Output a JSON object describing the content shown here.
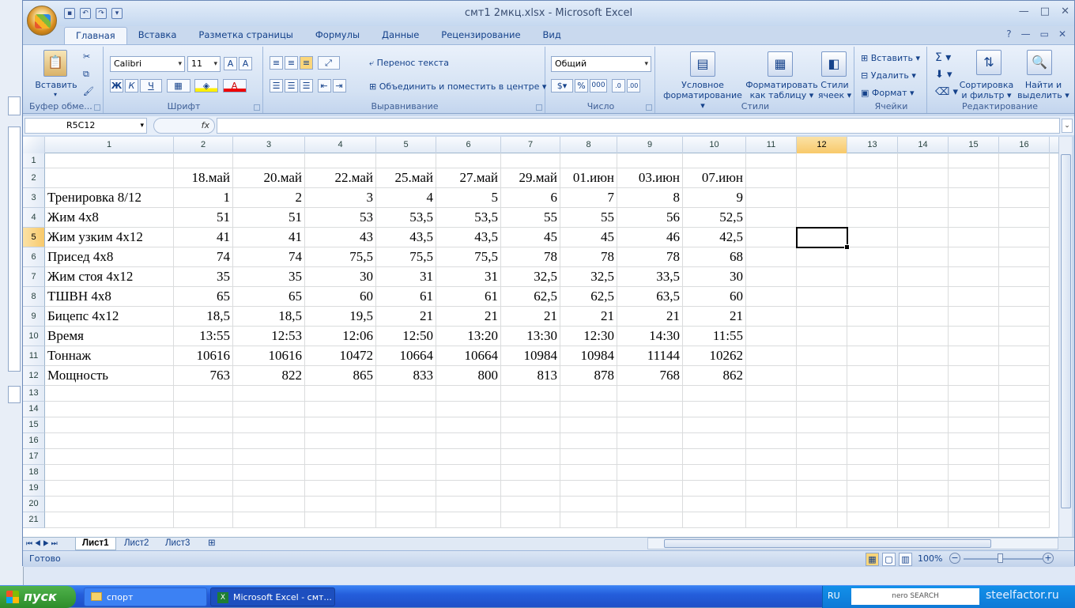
{
  "window": {
    "title": "смт1 2мкц.xlsx - Microsoft Excel"
  },
  "tabs": [
    "Главная",
    "Вставка",
    "Разметка страницы",
    "Формулы",
    "Данные",
    "Рецензирование",
    "Вид"
  ],
  "ribbon": {
    "clipboard": {
      "paste": "Вставить",
      "label": "Буфер обме..."
    },
    "font": {
      "name": "Calibri",
      "size": "11",
      "bold": "Ж",
      "italic": "К",
      "underline": "Ч",
      "label": "Шрифт"
    },
    "alignment": {
      "wrap": "Перенос текста",
      "merge": "Объединить и поместить в центре",
      "label": "Выравнивание"
    },
    "number": {
      "format": "Общий",
      "percent": "%",
      "thousands": "000",
      "label": "Число"
    },
    "styles": {
      "cond": [
        "Условное",
        "форматирование"
      ],
      "table": [
        "Форматировать",
        "как таблицу"
      ],
      "cells": [
        "Стили",
        "ячеек"
      ],
      "label": "Стили"
    },
    "cells": {
      "insert": "Вставить",
      "delete": "Удалить",
      "format": "Формат",
      "label": "Ячейки"
    },
    "editing": {
      "sort": [
        "Сортировка",
        "и фильтр"
      ],
      "find": [
        "Найти и",
        "выделить"
      ],
      "label": "Редактирование"
    }
  },
  "formula_bar": {
    "namebox": "R5C12",
    "fx": "fx",
    "value": ""
  },
  "grid": {
    "col_headers": [
      "1",
      "2",
      "3",
      "4",
      "5",
      "6",
      "7",
      "8",
      "9",
      "10",
      "11",
      "12",
      "13",
      "14",
      "15",
      "16"
    ],
    "row_headers": [
      "1",
      "2",
      "3",
      "4",
      "5",
      "6",
      "7",
      "8",
      "9",
      "10",
      "11",
      "12",
      "13",
      "14",
      "15",
      "16",
      "17",
      "18",
      "19",
      "20",
      "21"
    ],
    "rows": [
      [
        "",
        "",
        "",
        "",
        "",
        "",
        "",
        "",
        "",
        ""
      ],
      [
        "",
        "18.май",
        "20.май",
        "22.май",
        "25.май",
        "27.май",
        "29.май",
        "01.июн",
        "03.июн",
        "07.июн"
      ],
      [
        "Тренировка 8/12",
        "1",
        "2",
        "3",
        "4",
        "5",
        "6",
        "7",
        "8",
        "9"
      ],
      [
        "Жим 4х8",
        "51",
        "51",
        "53",
        "53,5",
        "53,5",
        "55",
        "55",
        "56",
        "52,5"
      ],
      [
        "Жим узким 4х12",
        "41",
        "41",
        "43",
        "43,5",
        "43,5",
        "45",
        "45",
        "46",
        "42,5"
      ],
      [
        "Присед 4х8",
        "74",
        "74",
        "75,5",
        "75,5",
        "75,5",
        "78",
        "78",
        "78",
        "68"
      ],
      [
        "Жим стоя 4х12",
        "35",
        "35",
        "30",
        "31",
        "31",
        "32,5",
        "32,5",
        "33,5",
        "30"
      ],
      [
        "ТШВН 4х8",
        "65",
        "65",
        "60",
        "61",
        "61",
        "62,5",
        "62,5",
        "63,5",
        "60"
      ],
      [
        "Бицепс 4х12",
        "18,5",
        "18,5",
        "19,5",
        "21",
        "21",
        "21",
        "21",
        "21",
        "21"
      ],
      [
        "Время",
        "13:55",
        "12:53",
        "12:06",
        "12:50",
        "13:20",
        "13:30",
        "12:30",
        "14:30",
        "11:55"
      ],
      [
        "Тоннаж",
        "10616",
        "10616",
        "10472",
        "10664",
        "10664",
        "10984",
        "10984",
        "11144",
        "10262"
      ],
      [
        "Мощность",
        "763",
        "822",
        "865",
        "833",
        "800",
        "813",
        "878",
        "768",
        "862"
      ]
    ]
  },
  "sheets": [
    "Лист1",
    "Лист2",
    "Лист3"
  ],
  "status": {
    "ready": "Готово",
    "zoom": "100%"
  },
  "taskbar": {
    "start": "пуск",
    "items": [
      "спорт",
      "Microsoft Excel - смт..."
    ],
    "lang": "RU",
    "search": "nero SEARCH",
    "watermark": "steelfactor.ru"
  }
}
